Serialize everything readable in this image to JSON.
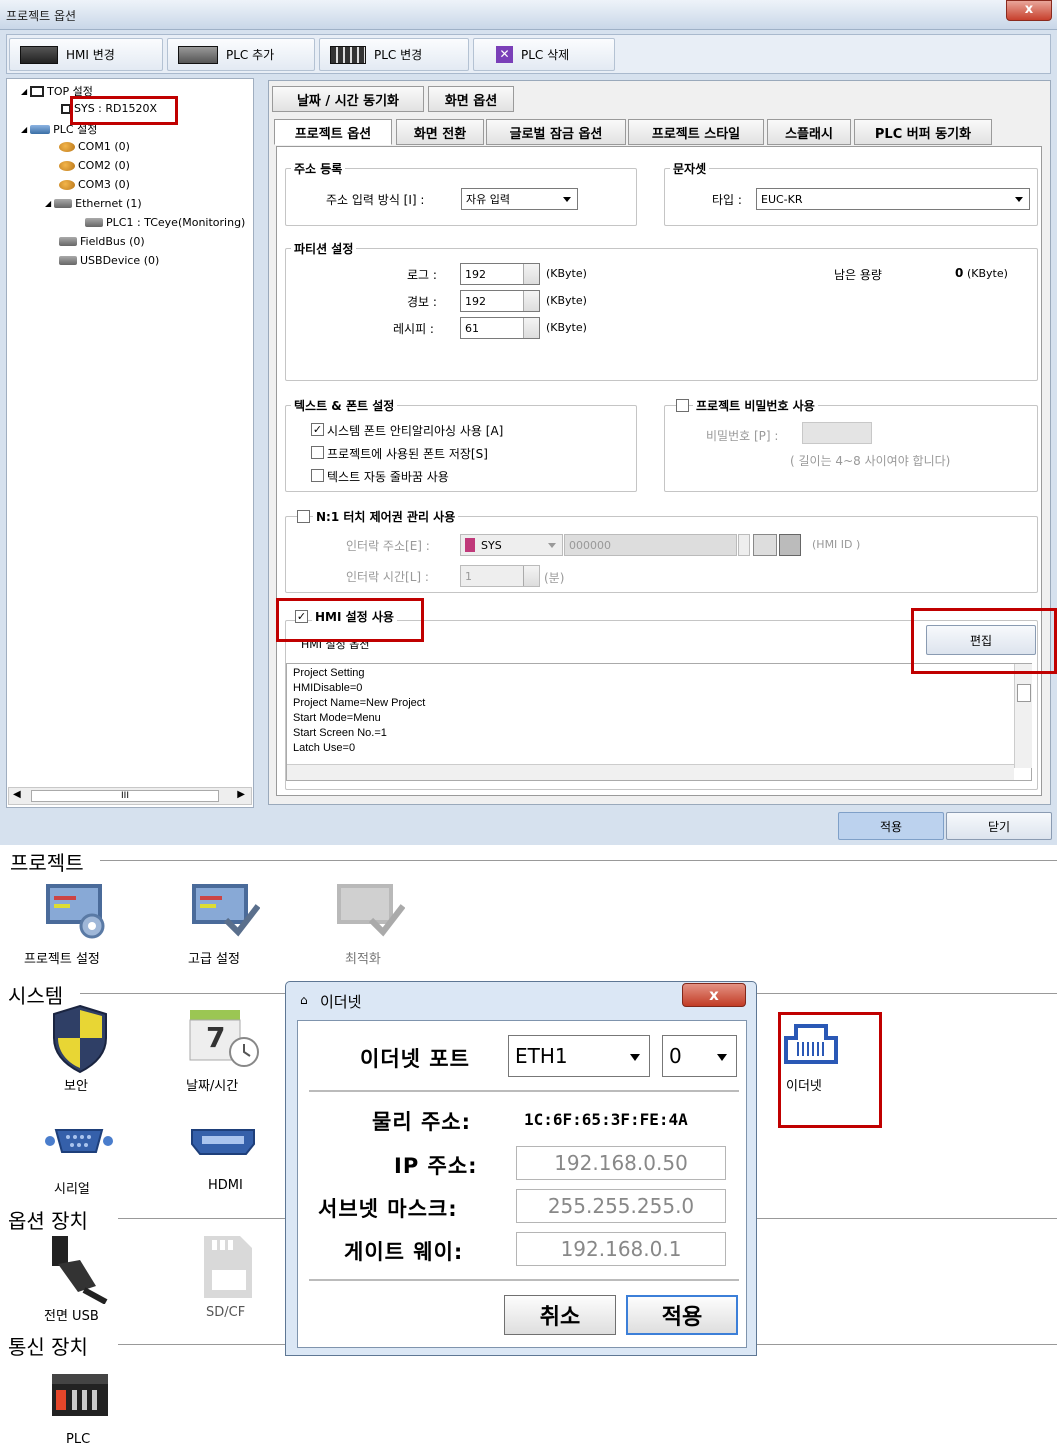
{
  "window": {
    "title": "프로젝트 옵션",
    "close": "x"
  },
  "toolbar": {
    "hmi_change": "HMI 변경",
    "plc_add": "PLC 추가",
    "plc_change": "PLC 변경",
    "plc_delete": "PLC 삭제"
  },
  "tree": {
    "top": "TOP 설정",
    "sys": "SYS : RD1520X",
    "plc": "PLC 설정",
    "com1": "COM1 (0)",
    "com2": "COM2 (0)",
    "com3": "COM3 (0)",
    "ethernet": "Ethernet (1)",
    "plc1": "PLC1 : TCeye(Monitoring)",
    "fieldbus": "FieldBus (0)",
    "usbdevice": "USBDevice (0)",
    "scroll": "III"
  },
  "tabs": {
    "row1": [
      "날짜 / 시간 동기화",
      "화면 옵션"
    ],
    "row2": [
      "프로젝트 옵션",
      "화면 전환",
      "글로벌 잠금 옵션",
      "프로젝트 스타일",
      "스플래시",
      "PLC 버퍼 동기화"
    ]
  },
  "address": {
    "title": "주소 등록",
    "label": "주소 입력 방식 [I] :",
    "value": "자유 입력"
  },
  "charset": {
    "title": "문자셋",
    "label": "타입 :",
    "value": "EUC-KR"
  },
  "partition": {
    "title": "파티션 설정",
    "log_label": "로그 :",
    "log_value": "192",
    "alarm_label": "경보 :",
    "alarm_value": "192",
    "recipe_label": "레시피 :",
    "recipe_value": "61",
    "unit": "(KByte)",
    "remain_label": "남은 용량",
    "remain_value": "0",
    "remain_unit": "(KByte)"
  },
  "text_font": {
    "title": "텍스트 & 폰트 설정",
    "opt1": "시스템 폰트 안티알리아싱 사용 [A]",
    "opt2": "프로젝트에 사용된 폰트 저장[S]",
    "opt3": "텍스트 자동 줄바꿈 사용"
  },
  "password": {
    "title": "프로젝트 비밀번호 사용",
    "label": "비밀번호 [P] :",
    "hint": "( 길이는 4~8 사이여야 합니다)"
  },
  "touch": {
    "title": "N:1 터치 제어권 관리 사용",
    "addr_label": "인터락 주소[E] :",
    "addr_device": "SYS",
    "addr_value": "000000",
    "hmi_id": "(HMI ID )",
    "time_label": "인터락 시간[L] :",
    "time_value": "1",
    "time_unit": "(분)"
  },
  "hmi": {
    "title": "HMI 설정 사용",
    "sub": "HMI 설정 옵션",
    "edit": "편집",
    "lines": [
      "Project Setting",
      "HMIDisable=0",
      "Project Name=New Project",
      "Start Mode=Menu",
      "Start Screen No.=1",
      "Latch Use=0"
    ]
  },
  "footer": {
    "apply": "적용",
    "close": "닫기"
  },
  "settings": {
    "sec_project": "프로젝트",
    "sec_system": "시스템",
    "sec_option": "옵션 장치",
    "sec_comm": "통신 장치",
    "project_setting": "프로젝트 설정",
    "advanced": "고급 설정",
    "optimize": "최적화",
    "security": "보안",
    "datetime": "날짜/시간",
    "datetime_num": "7",
    "serial": "시리얼",
    "hdmi": "HDMI",
    "ethernet": "이더넷",
    "front_usb": "전면 USB",
    "sdcf": "SD/CF",
    "plc": "PLC"
  },
  "ethernet_dialog": {
    "title": "이더넷",
    "close": "x",
    "port_label": "이더넷 포트",
    "port_value": "ETH1",
    "port_index": "0",
    "mac_label": "물리 주소:",
    "mac_value": "1C:6F:65:3F:FE:4A",
    "ip_label": "IP 주소:",
    "ip_value": "192.168.0.50",
    "subnet_label": "서브넷 마스크:",
    "subnet_value": "255.255.255.0",
    "gateway_label": "게이트 웨이:",
    "gateway_value": "192.168.0.1",
    "cancel": "취소",
    "apply": "적용"
  },
  "colors": {
    "highlight": "#c00000",
    "window_bg": "#d6e1ee",
    "apply_button": "#bcd2ee"
  }
}
